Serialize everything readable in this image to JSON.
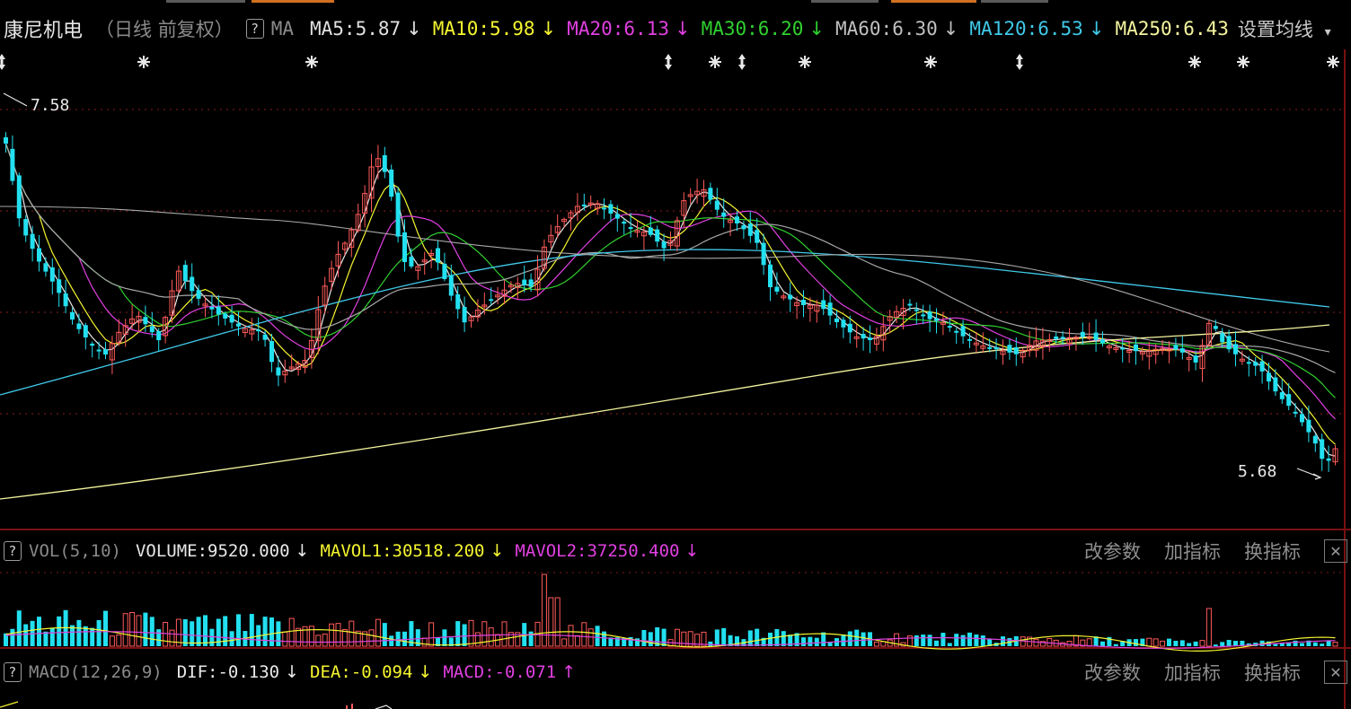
{
  "header": {
    "stock_name": "康尼机电",
    "period_label": "（日线 前复权）",
    "help_glyph": "?",
    "indicator": "MA",
    "ma_items": [
      {
        "label": "MA5:5.87",
        "arrow": "↓",
        "color": "#e0e0e0"
      },
      {
        "label": "MA10:5.98",
        "arrow": "↓",
        "color": "#f5f530"
      },
      {
        "label": "MA20:6.13",
        "arrow": "↓",
        "color": "#e040e0"
      },
      {
        "label": "MA30:6.20",
        "arrow": "↓",
        "color": "#30d030"
      },
      {
        "label": "MA60:6.30",
        "arrow": "↓",
        "color": "#c0c0c0"
      },
      {
        "label": "MA120:6.53",
        "arrow": "↓",
        "color": "#40c8e8"
      },
      {
        "label": "MA250:6.43",
        "arrow": "",
        "color": "#f5f5a0"
      }
    ],
    "settings_label": "设置均线",
    "settings_arrow": "▾"
  },
  "price_chart": {
    "high_label": "7.58",
    "low_label": "5.68",
    "up_color": "#ff5a5a",
    "down_color": "#22e0f0",
    "ma_colors": {
      "ma5": "#e8e8e8",
      "ma10": "#f5f530",
      "ma20": "#e040e0",
      "ma30": "#30d030",
      "ma60": "#a8a8a8",
      "ma120": "#40c8e8",
      "ma250": "#f5f5a0"
    }
  },
  "volume_panel": {
    "help_glyph": "?",
    "title": "VOL(5,10)",
    "volume": "VOLUME:9520.000",
    "volume_arrow": "↓",
    "mavol1": "MAVOL1:30518.200",
    "mavol1_arrow": "↓",
    "mavol2": "MAVOL2:37250.400",
    "mavol2_arrow": "↓",
    "tools": [
      "改参数",
      "加指标",
      "换指标"
    ],
    "close_glyph": "✕"
  },
  "macd_panel": {
    "help_glyph": "?",
    "title": "MACD(12,26,9)",
    "dif": "DIF:-0.130",
    "dif_arrow": "↓",
    "dea": "DEA:-0.094",
    "dea_arrow": "↓",
    "macd": "MACD:-0.071",
    "macd_arrow": "↑",
    "tools": [
      "改参数",
      "加指标",
      "换指标"
    ],
    "close_glyph": "✕"
  }
}
